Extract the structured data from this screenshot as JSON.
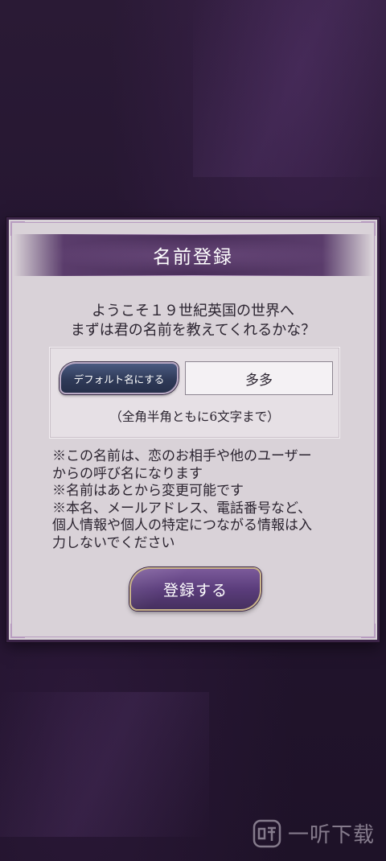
{
  "dialog": {
    "title": "名前登録",
    "message_lines": [
      "ようこそ１９世紀英国の世界へ",
      "まずは君の名前を教えてくれるかな？"
    ],
    "default_name_button": "デフォルト名にする",
    "name_input_value": "多多",
    "limit_note": "（全角半角ともに6文字まで）",
    "notes": [
      "※この名前は、恋のお相手や他のユーザー",
      "からの呼び名になります",
      "※名前はあとから変更可能です",
      "※本名、メールアドレス、電話番号など、",
      "個人情報や個人の特定につながる情報は入",
      "力しないでください"
    ],
    "register_button": "登録する"
  },
  "watermark": {
    "text": "一听下载"
  },
  "colors": {
    "background": "#241530",
    "dialog_bg": "#d9d2d8",
    "title_bar": "#4a2f5a",
    "default_button": "#2f3a58",
    "register_button": "#5b3d7c",
    "gold_border": "#c9b48a"
  }
}
